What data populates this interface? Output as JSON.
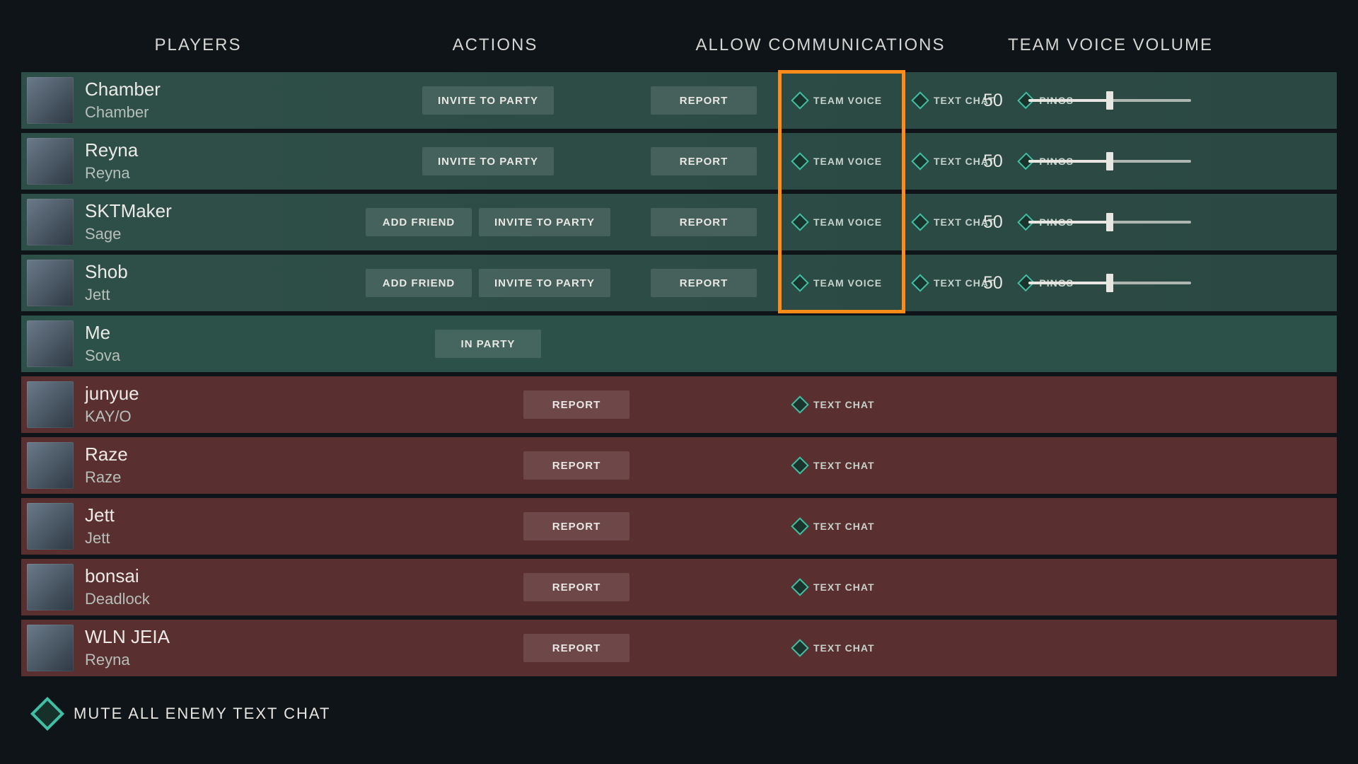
{
  "headers": {
    "players": "PLAYERS",
    "actions": "ACTIONS",
    "comms": "ALLOW COMMUNICATIONS",
    "volume": "TEAM VOICE VOLUME"
  },
  "buttons": {
    "add_friend": "ADD FRIEND",
    "invite": "INVITE TO PARTY",
    "report": "REPORT",
    "in_party": "IN PARTY"
  },
  "comms": {
    "team_voice": "TEAM VOICE",
    "text_chat": "TEXT CHAT",
    "pings": "PINGS"
  },
  "footer": {
    "mute_all": "MUTE ALL ENEMY TEXT CHAT"
  },
  "highlight": {
    "team_voice_rows": true
  },
  "players": [
    {
      "side": "ally",
      "name": "Chamber",
      "agent": "Chamber",
      "add_friend": false,
      "invite": true,
      "report": true,
      "team_voice": true,
      "text_chat": true,
      "pings": true,
      "volume": 50
    },
    {
      "side": "ally",
      "name": "Reyna",
      "agent": "Reyna",
      "add_friend": false,
      "invite": true,
      "report": true,
      "team_voice": true,
      "text_chat": true,
      "pings": true,
      "volume": 50
    },
    {
      "side": "ally",
      "name": "SKTMaker",
      "agent": "Sage",
      "add_friend": true,
      "invite": true,
      "report": true,
      "team_voice": true,
      "text_chat": true,
      "pings": true,
      "volume": 50
    },
    {
      "side": "ally",
      "name": "Shob",
      "agent": "Jett",
      "add_friend": true,
      "invite": true,
      "report": true,
      "team_voice": true,
      "text_chat": true,
      "pings": true,
      "volume": 50
    },
    {
      "side": "me",
      "name": "Me",
      "agent": "Sova",
      "in_party": true
    },
    {
      "side": "enemy",
      "name": "junyue",
      "agent": "KAY/O",
      "report": true,
      "text_chat": true
    },
    {
      "side": "enemy",
      "name": "Raze",
      "agent": "Raze",
      "report": true,
      "text_chat": true
    },
    {
      "side": "enemy",
      "name": "Jett",
      "agent": "Jett",
      "report": true,
      "text_chat": true
    },
    {
      "side": "enemy",
      "name": "bonsai",
      "agent": "Deadlock",
      "report": true,
      "text_chat": true
    },
    {
      "side": "enemy",
      "name": "WLN JEIA",
      "agent": "Reyna",
      "report": true,
      "text_chat": true
    }
  ]
}
